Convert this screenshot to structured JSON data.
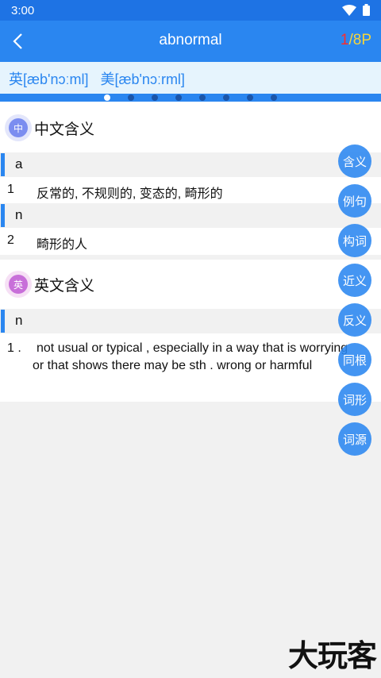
{
  "status_bar": {
    "time": "3:00"
  },
  "header": {
    "title": "abnormal",
    "page_current": "1",
    "page_rest": "/8P"
  },
  "phonetics": {
    "uk": "英[æb'nɔːml]",
    "us": "美[æb'nɔːrml]"
  },
  "pager": {
    "count": 8,
    "active_index": 0
  },
  "chinese_section": {
    "badge": "中",
    "title": "中文含义",
    "entries": [
      {
        "pos": "a",
        "num": "1",
        "text": "反常的, 不规则的, 变态的, 畸形的"
      },
      {
        "pos": "n",
        "num": "2",
        "text": "畸形的人"
      }
    ]
  },
  "english_section": {
    "badge": "英",
    "title": "英文含义",
    "pos": "n",
    "num": "1 .",
    "line1": "not usual or typical , especially in a way that is worrying",
    "line2": "or that shows there may be sth . wrong or harmful"
  },
  "side_menu": [
    "含义",
    "例句",
    "构词",
    "近义",
    "反义",
    "同根",
    "词形",
    "词源"
  ],
  "watermark": "大玩客",
  "colors": {
    "primary": "#2a86f0",
    "status": "#1e73e4",
    "phonetic_bg": "#e6f4fd",
    "page_current": "#ff2b2b",
    "page_rest": "#f6d53b"
  }
}
